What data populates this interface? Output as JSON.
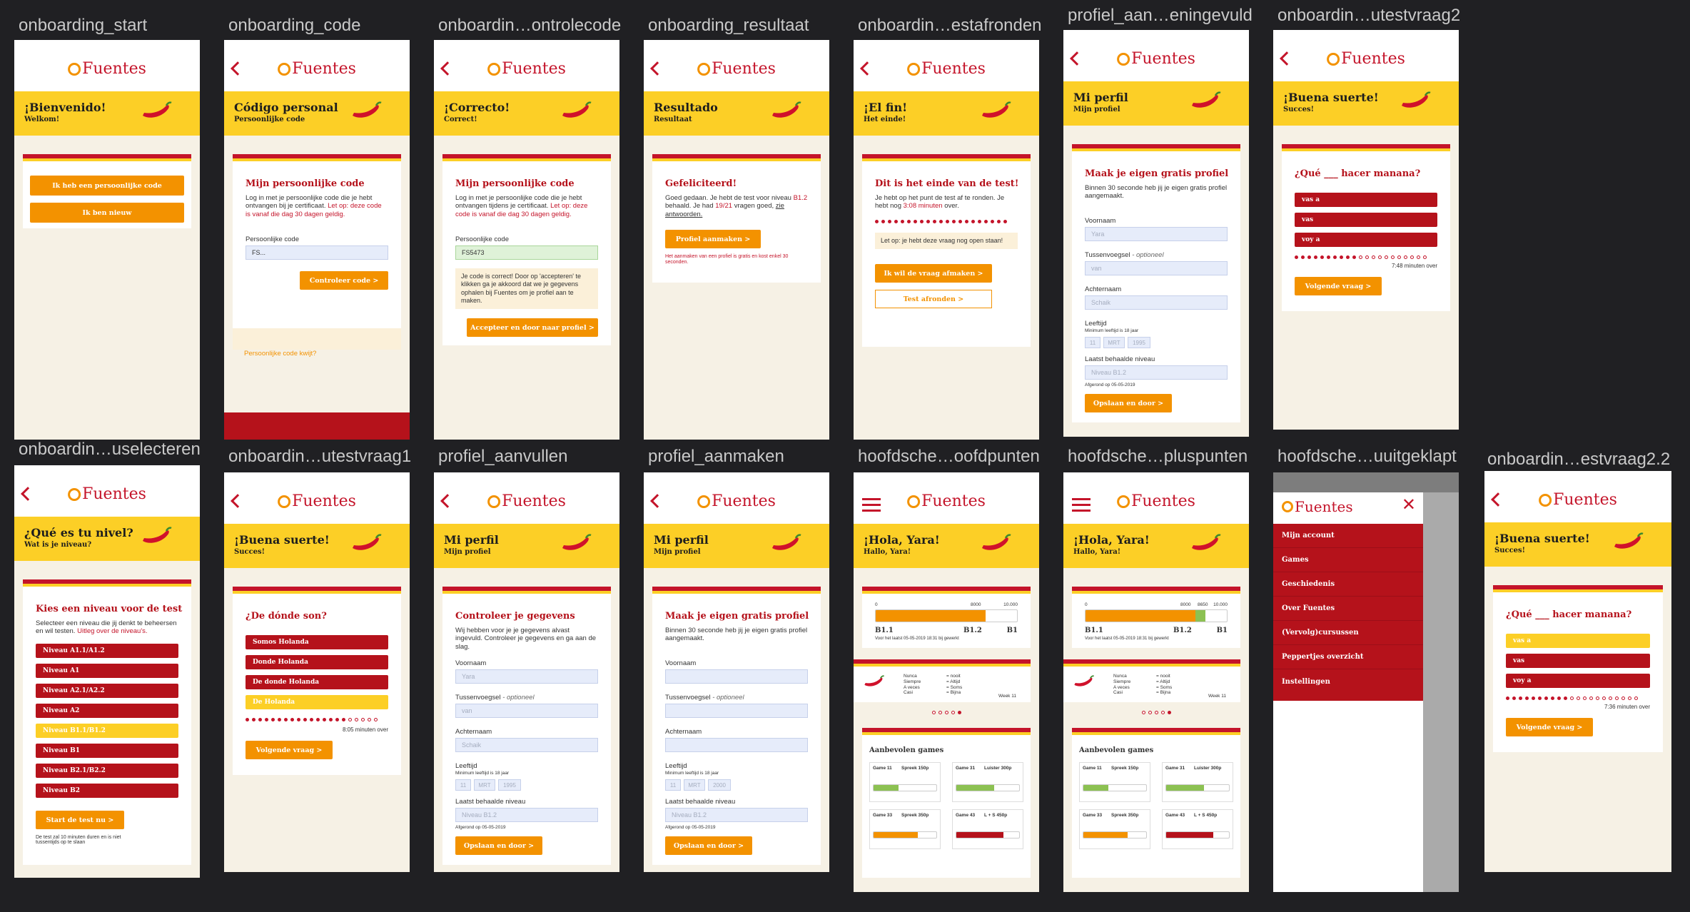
{
  "labels": {
    "s1": "onboarding_start",
    "s2": "onboarding_code",
    "s3": "onboardin…ontrolecode",
    "s4": "onboarding_resultaat",
    "s5": "onboardin…estafronden",
    "s6": "profiel_aan…eningevuld",
    "s7": "onboardin…utestvraag2",
    "s8": "onboardin…uselecteren",
    "s9": "onboardin…utestvraag1",
    "s10": "profiel_aanvullen",
    "s11": "profiel_aanmaken",
    "s12": "hoofdsche…oofdpunten",
    "s13": "hoofdsche…pluspunten",
    "s14": "hoofdsche…uuitgeklapt",
    "s15": "onboardin…estvraag2.2"
  },
  "brand": "Fuentes",
  "colors": {
    "red": "#c4142a",
    "yellow": "#fccf26",
    "orange": "#f39200",
    "cream": "#f6f1e5"
  },
  "s1": {
    "title": "¡Bienvenido!",
    "subtitle": "Welkom!",
    "btn1": "Ik heb een persoonlijke code",
    "btn2": "Ik ben nieuw"
  },
  "s2": {
    "title": "Código personal",
    "subtitle": "Persoonlijke code",
    "card_title": "Mijn persoonlijke code",
    "text1": "Log in met je persoonlijke code die je hebt ontvangen bij je certificaat.",
    "text1_red": "Let op: deze code is vanaf die dag 30 dagen geldig.",
    "field_label": "Persoonlijke code",
    "field_value": "FS...",
    "btn": "Controleer code >",
    "forgot": "Persoonlijke code kwijt?"
  },
  "s3": {
    "title": "¡Correcto!",
    "subtitle": "Correct!",
    "card_title": "Mijn persoonlijke code",
    "text1": "Log in met je persoonlijke code die je hebt ontvangen tijdens je certificaat.",
    "text1_red": "Let op: deze code is vanaf die dag 30 dagen geldig.",
    "field_label": "Persoonlijke code",
    "field_value": "FS5473",
    "note": "Je code is correct! Door op 'accepteren' te klikken ga je akkoord dat we je gegevens ophalen bij Fuentes om je profiel aan te maken.",
    "btn": "Accepteer en door naar profiel >"
  },
  "s4": {
    "title": "Resultado",
    "subtitle": "Resultaat",
    "card_title": "Gefeliciteerd!",
    "text_a": "Goed gedaan. Je hebt de test voor niveau",
    "level": "B1.2",
    "text_b": "behaald. Je had",
    "score": "19/21",
    "text_c": "vragen goed,",
    "link": "zie antwoorden.",
    "btn": "Profiel aanmaken >",
    "small": "Het aanmaken van een profiel is gratis en kost enkel 30 seconden."
  },
  "s5": {
    "title": "¡El fin!",
    "subtitle": "Het einde!",
    "card_title": "Dit is het einde van de test!",
    "text1": "Je hebt op het punt de test af te ronden. Je hebt nog",
    "time": "3:08 minuten",
    "text1b": "over.",
    "note": "Let op: je hebt deze vraag nog open staan!",
    "btn1": "Ik wil de vraag afmaken >",
    "btn2": "Test afronden >"
  },
  "s6": {
    "title": "Mi perfil",
    "subtitle": "Mijn profiel",
    "card_title": "Maak je eigen gratis profiel",
    "text1": "Binnen 30 seconde heb jij je eigen gratis profiel aangemaakt.",
    "f1": "Voornaam",
    "v1": "Yara",
    "f2": "Tussenvoegsel",
    "f2opt": "- optioneel",
    "v2": "van",
    "f3": "Achternaam",
    "v3": "Schaik",
    "f4": "Leeftijd",
    "f4sub": "Minimum leeftijd is 18 jaar",
    "d": "11",
    "m": "MRT",
    "y": "1995",
    "f5": "Laatst behaalde niveau",
    "v5": "Niveau B1.2",
    "f5sub": "Afgerond op 05-05-2019",
    "btn": "Opslaan en door >"
  },
  "s7": {
    "title": "¡Buena suerte!",
    "subtitle": "Succes!",
    "question": "¿Qué ___ hacer manana?",
    "o1": "vas a",
    "o2": "vas",
    "o3": "voy a",
    "time": "7:48 minuten over",
    "btn": "Volgende vraag >"
  },
  "s8": {
    "title": "¿Qué es tu nivel?",
    "subtitle": "Wat is je niveau?",
    "card_title": "Kies een niveau voor de test",
    "text1": "Selecteer een niveau die jij denkt te beheersen en wil testen.",
    "link": "Uitleg over de niveau's.",
    "levels": [
      "Niveau A1.1/A1.2",
      "Niveau A1",
      "Niveau A2.1/A2.2",
      "Niveau A2",
      "Niveau B1.1/B1.2",
      "Niveau B1",
      "Niveau B2.1/B2.2",
      "Niveau B2"
    ],
    "btn": "Start de test nu >",
    "foot": "De test zal 10 minuten duren en is niet tussentijds op te slaan"
  },
  "s9": {
    "title": "¡Buena suerte!",
    "subtitle": "Succes!",
    "question": "¿De dónde son?",
    "o1": "Somos Holanda",
    "o2": "Donde Holanda",
    "o3": "De donde Holanda",
    "o4": "De Holanda",
    "time": "8:05 minuten over",
    "btn": "Volgende vraag >"
  },
  "s10": {
    "title": "Mi perfil",
    "subtitle": "Mijn profiel",
    "card_title": "Controleer je gegevens",
    "text1": "Wij hebben voor je je gegevens alvast ingevuld. Controleer je gegevens en ga aan de slag.",
    "f1": "Voornaam",
    "v1": "Yara",
    "f2": "Tussenvoegsel",
    "f2opt": "- optioneel",
    "v2": "van",
    "f3": "Achternaam",
    "v3": "Schaik",
    "f4": "Leeftijd",
    "f4sub": "Minimum leeftijd is 18 jaar",
    "d": "11",
    "m": "MRT",
    "y": "1995",
    "f5": "Laatst behaalde niveau",
    "v5": "Niveau B1.2",
    "f5sub": "Afgerond op 05-05-2019",
    "btn": "Opslaan en door >"
  },
  "s11": {
    "title": "Mi perfil",
    "subtitle": "Mijn profiel",
    "card_title": "Maak je eigen gratis profiel",
    "text1": "Binnen 30 seconde heb jij je eigen gratis profiel aangemaakt.",
    "f1": "Voornaam",
    "f2": "Tussenvoegsel",
    "f2opt": "- optioneel",
    "f3": "Achternaam",
    "f4": "Leeftijd",
    "f4sub": "Minimum leeftijd is 18 jaar",
    "d": "11",
    "m": "MRT",
    "y": "2000",
    "f5": "Laatst behaalde niveau",
    "v5": "Niveau B1.2",
    "f5sub": "Afgerond op 05-05-2019",
    "btn": "Opslaan en door >"
  },
  "home": {
    "title": "¡Hola, Yara!",
    "subtitle": "Hallo, Yara!",
    "scale0": "0",
    "scale1": "8000",
    "scale2": "10.000",
    "scale1b": "8650",
    "lv1": "B1.1",
    "lv2": "B1.2",
    "lv3": "B1",
    "progress_note": "Voor het laatst 05-05-2019 18:31 bij gewerkt",
    "wordsA": "Nunca\nSiempre\nA veces\nCasi",
    "wordsB": "= nooit\n= Altijd\n= Soms\n= Bijna",
    "week": "Week 11",
    "games_title": "Aanbevolen games",
    "g1": "Game 11",
    "g1b": "Spreek 150p",
    "g2": "Game 31",
    "g2b": "Luister 300p",
    "g3": "Game 33",
    "g3b": "Spreek 350p",
    "g4": "Game 43",
    "g4b": "L + S 450p",
    "home_progress": 0.78,
    "plus_progress": 0.85
  },
  "menu": {
    "items": [
      "Mijn account",
      "Games",
      "Geschiedenis",
      "Over Fuentes",
      "(Vervolg)cursussen",
      "Peppertjes overzicht",
      "Instellingen"
    ]
  },
  "s15": {
    "title": "¡Buena suerte!",
    "subtitle": "Succes!",
    "question": "¿Qué ___ hacer manana?",
    "o1": "vas a",
    "o2": "vas",
    "o3": "voy a",
    "time": "7:36 minuten over",
    "btn": "Volgende vraag >"
  }
}
